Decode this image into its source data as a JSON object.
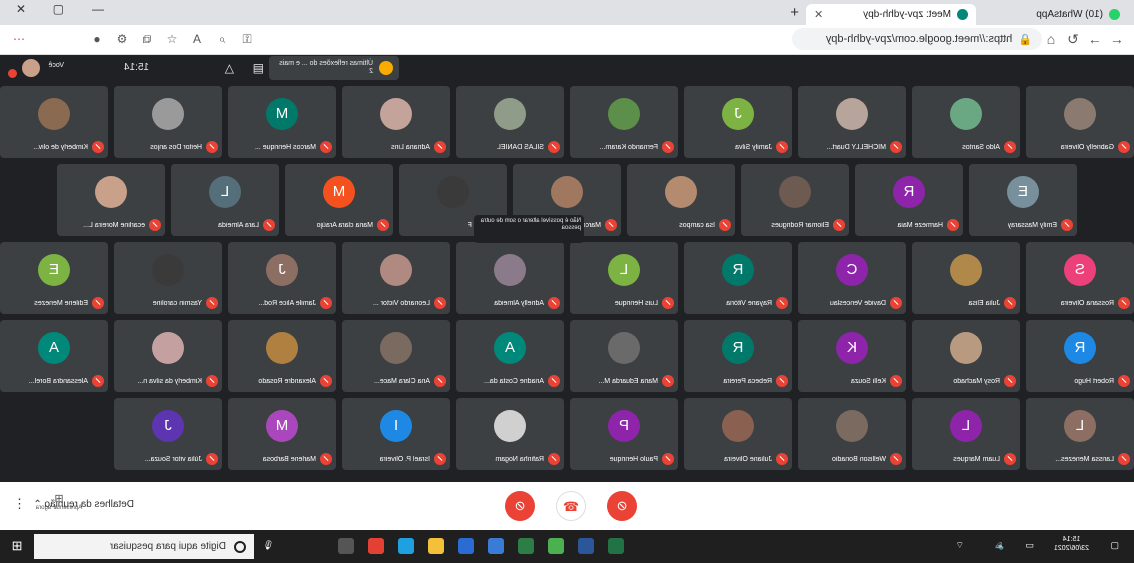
{
  "browser": {
    "tabs": [
      {
        "title": "(10) WhatsApp",
        "active": false,
        "favicon_color": "#25d366"
      },
      {
        "title": "Meet: zpv-ydhh-dpy",
        "active": true,
        "favicon_color": "#00897b"
      }
    ],
    "new_tab": "+",
    "address": "https://meet.google.com/zpv-ydhh-dpy",
    "window_controls": [
      "—",
      "▢",
      "✕"
    ]
  },
  "meet_top": {
    "user_label": "Você",
    "time": "15:14",
    "chip_text": "Últimas reflexões do ... e mais 2"
  },
  "participants": [
    {
      "name": "Gabrielly Oliveira",
      "type": "photo",
      "color": "#8a7a70"
    },
    {
      "name": "Aldo Santos",
      "type": "photo",
      "color": "#6aa884"
    },
    {
      "name": "MICHELLY Duart...",
      "type": "photo",
      "color": "#b7a49a"
    },
    {
      "name": "Jamily Silva",
      "type": "letter",
      "letter": "J",
      "color": "#7cb342"
    },
    {
      "name": "Fernando Karam...",
      "type": "photo",
      "color": "#5c8f4a"
    },
    {
      "name": "SILAS DANIEL",
      "type": "photo",
      "color": "#8f9c8a"
    },
    {
      "name": "Adriana Lins",
      "type": "photo",
      "color": "#c4a39a"
    },
    {
      "name": "Marcos Henrique ...",
      "type": "letter",
      "letter": "M",
      "color": "#00796b"
    },
    {
      "name": "Heitor Dos anjos",
      "type": "photo",
      "color": "#9a9a9a"
    },
    {
      "name": "Kimberly de oliv...",
      "type": "photo",
      "color": "#8a6a50"
    },
    {
      "name": "Emily Massaray",
      "type": "letter",
      "letter": "E",
      "color": "#78909c"
    },
    {
      "name": "Harmeze Maia",
      "type": "letter",
      "letter": "R",
      "color": "#8e24aa"
    },
    {
      "name": "Eliomar Rodrigues",
      "type": "photo",
      "color": "#6d5a50"
    },
    {
      "name": "Isa campos",
      "type": "photo",
      "color": "#b58b70"
    },
    {
      "name": "Marcos rocha",
      "type": "photo",
      "color": "#a07860"
    },
    {
      "name": "Lele F",
      "type": "photo",
      "color": "#3a3a3a"
    },
    {
      "name": "Maria clara Araújo",
      "type": "letter",
      "letter": "M",
      "color": "#f4511e"
    },
    {
      "name": "Lara Almeida",
      "type": "letter",
      "letter": "L",
      "color": "#546e7a"
    },
    {
      "name": "ecarline Moreira L...",
      "type": "photo",
      "color": "#c9a08a"
    },
    {
      "name": "Rossana Oliveira",
      "type": "letter",
      "letter": "S",
      "color": "#ec407a"
    },
    {
      "name": "Julia Elisa",
      "type": "photo",
      "color": "#b0894a"
    },
    {
      "name": "Davide Venceslau",
      "type": "letter",
      "letter": "C",
      "color": "#8e24aa"
    },
    {
      "name": "Rayane Vitória",
      "type": "letter",
      "letter": "R",
      "color": "#00796b"
    },
    {
      "name": "Luis Henrique",
      "type": "letter",
      "letter": "L",
      "color": "#7cb342"
    },
    {
      "name": "Adrielly Almeida",
      "type": "photo",
      "color": "#8a7a8a"
    },
    {
      "name": "Leonardo Victor ...",
      "type": "photo",
      "color": "#b08a80"
    },
    {
      "name": "Jamile Alice Rod...",
      "type": "letter",
      "letter": "J",
      "color": "#8d6e63"
    },
    {
      "name": "Yasmin caroline",
      "type": "photo",
      "color": "#3a3a3a"
    },
    {
      "name": "Edilene Menezes",
      "type": "letter",
      "letter": "E",
      "color": "#7cb342"
    },
    {
      "name": "Robert Hugo",
      "type": "letter",
      "letter": "R",
      "color": "#1e88e5"
    },
    {
      "name": "Rosy Machado",
      "type": "photo",
      "color": "#b89a80"
    },
    {
      "name": "Kelli Souza",
      "type": "letter",
      "letter": "K",
      "color": "#8e24aa"
    },
    {
      "name": "Rebeca Pereira",
      "type": "letter",
      "letter": "R",
      "color": "#00796b"
    },
    {
      "name": "Maria Eduarda M...",
      "type": "photo",
      "color": "#6a6a6a"
    },
    {
      "name": "Ariadne Costa da...",
      "type": "letter",
      "letter": "A",
      "color": "#00897b"
    },
    {
      "name": "Ana Clara Mace...",
      "type": "photo",
      "color": "#7a6a60"
    },
    {
      "name": "Alexandre Rosado",
      "type": "photo",
      "color": "#b08040"
    },
    {
      "name": "Kimberly da silva n...",
      "type": "photo",
      "color": "#c4a0a0"
    },
    {
      "name": "Alessandra Borel...",
      "type": "letter",
      "letter": "A",
      "color": "#00897b"
    },
    {
      "name": "Larissa Menezes...",
      "type": "letter",
      "letter": "L",
      "color": "#8d6e63"
    },
    {
      "name": "Luam Marques",
      "type": "letter",
      "letter": "L",
      "color": "#8e24aa"
    },
    {
      "name": "Wellison Bonadio",
      "type": "photo",
      "color": "#7a6a60"
    },
    {
      "name": "Juliane Oliveira",
      "type": "photo",
      "color": "#8a6050"
    },
    {
      "name": "Paulo Henrique",
      "type": "letter",
      "letter": "P",
      "color": "#8e24aa"
    },
    {
      "name": "Rafinha Nogam",
      "type": "photo",
      "color": "#d0d0d0"
    },
    {
      "name": "Israel P. Oliveira",
      "type": "letter",
      "letter": "I",
      "color": "#1e88e5"
    },
    {
      "name": "Marlene Barbosa",
      "type": "letter",
      "letter": "M",
      "color": "#ab47bc"
    },
    {
      "name": "Júlia vitor Souza...",
      "type": "letter",
      "letter": "J",
      "color": "#5e35b1"
    }
  ],
  "tooltip": "Não é possível alterar o som de outra pessoa",
  "controls": {
    "details_label": "Detalhes da reunião",
    "present_label": "Apresentar agora",
    "mic_icon": "mic-off-icon",
    "hangup_icon": "hang-up-icon",
    "camera_icon": "camera-off-icon"
  },
  "taskbar": {
    "search_placeholder": "Digite aqui para pesquisar",
    "clock_time": "15:14",
    "clock_date": "23/06/2021"
  }
}
